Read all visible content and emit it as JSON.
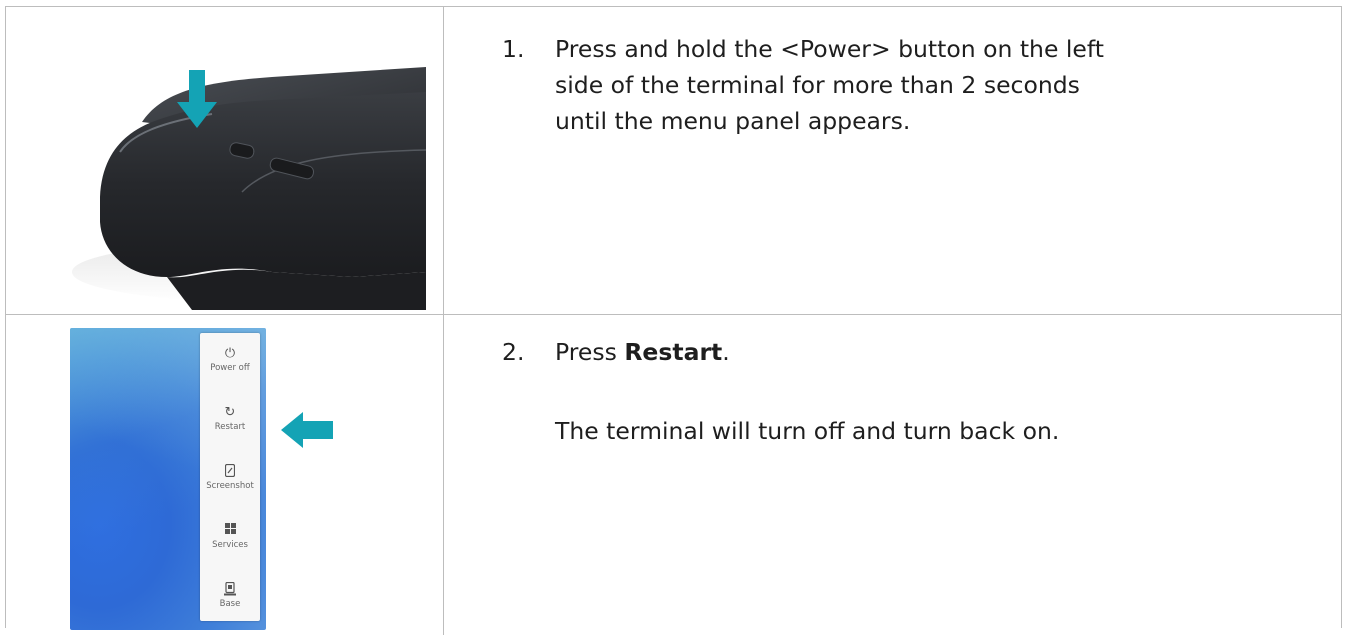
{
  "steps": [
    {
      "number": "1.",
      "text": "Press and hold the <Power> button on the left side of the terminal for more than 2 seconds until the menu panel appears.",
      "image": "terminal-side-power-button-photo"
    },
    {
      "number": "2.",
      "text_prefix": "Press ",
      "text_bold": "Restart",
      "text_suffix": ".",
      "subtext": "The terminal will turn off and turn back on.",
      "image": "power-menu-screenshot"
    }
  ],
  "power_menu": {
    "items": [
      {
        "label": "Power off",
        "icon": "power-icon"
      },
      {
        "label": "Restart",
        "icon": "restart-icon"
      },
      {
        "label": "Screenshot",
        "icon": "screenshot-icon"
      },
      {
        "label": "Services",
        "icon": "services-grid-icon"
      },
      {
        "label": "Base",
        "icon": "base-icon"
      }
    ]
  },
  "colors": {
    "arrow": "#14a3b5",
    "border": "#bdbdbd",
    "text": "#1e1e1e"
  }
}
